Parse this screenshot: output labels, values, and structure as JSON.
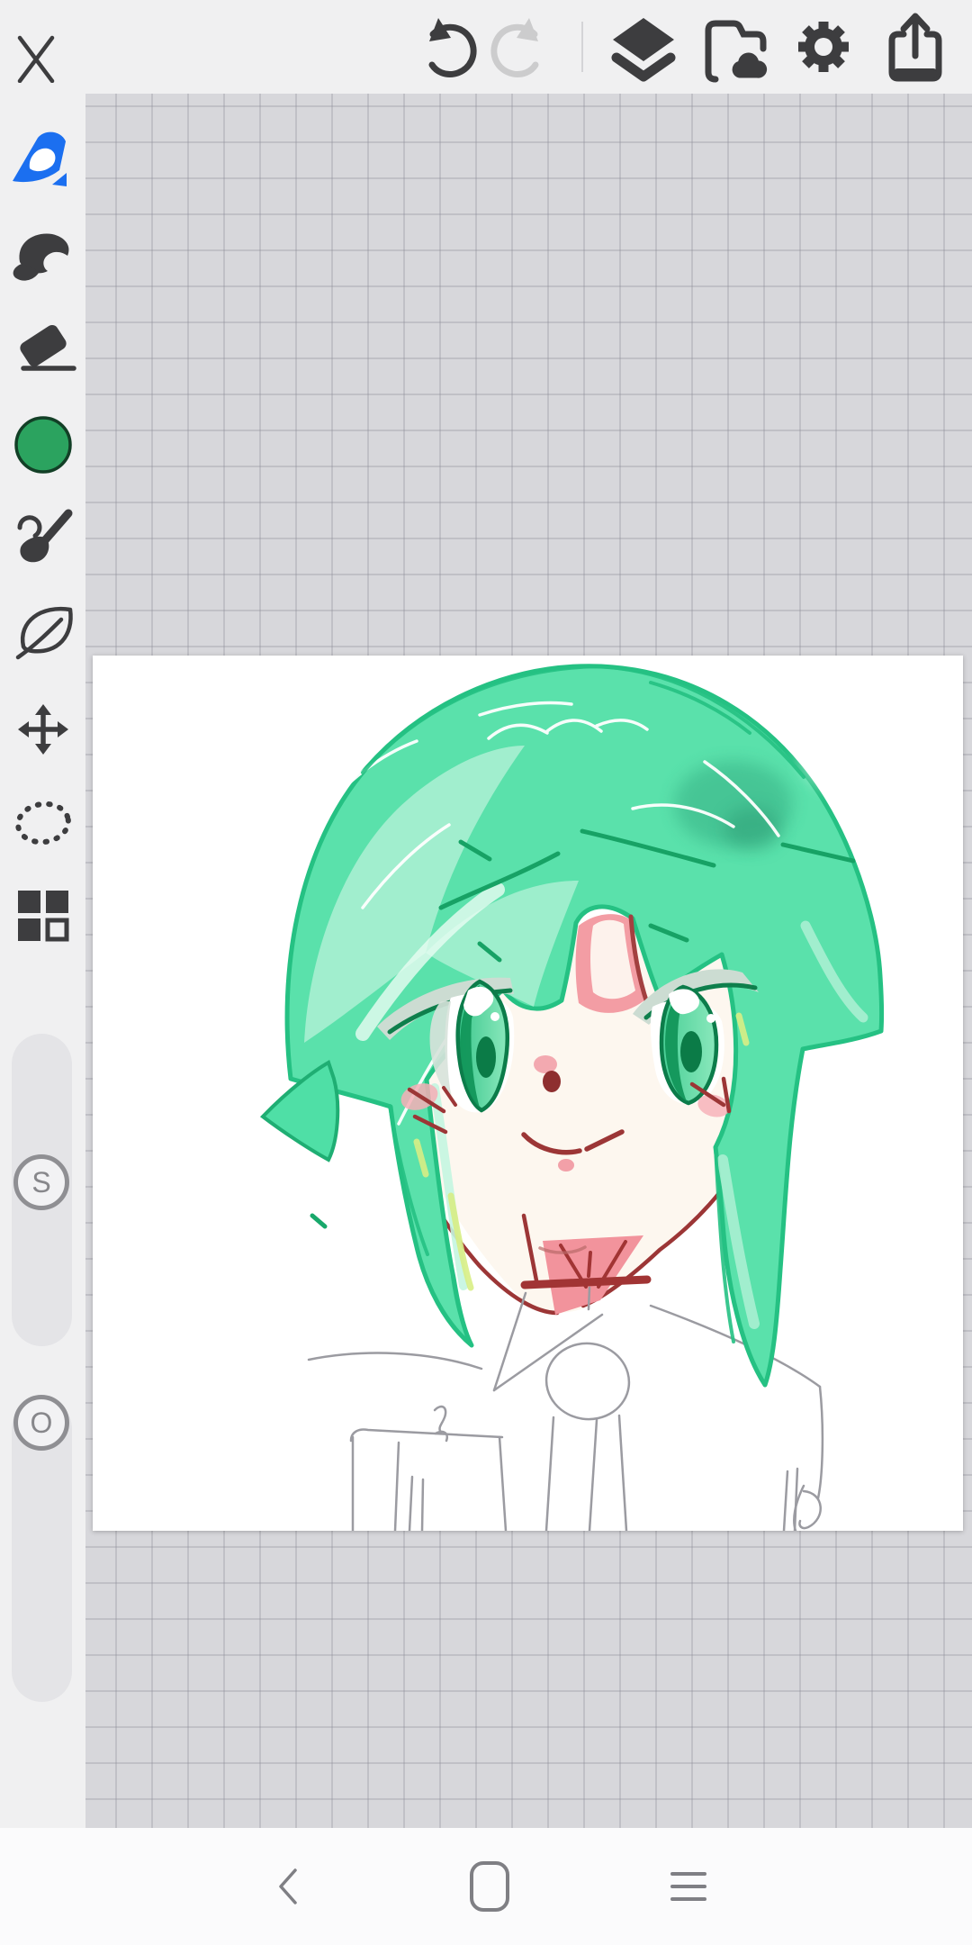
{
  "app": {
    "name": "mobile-painting-app",
    "view": "canvas-editor"
  },
  "topbar": {
    "close_label": "close",
    "undo_label": "undo",
    "undo_enabled": true,
    "redo_label": "redo",
    "redo_enabled": false,
    "layers_label": "layers",
    "gallery_label": "save-to-gallery",
    "settings_label": "settings",
    "share_label": "share",
    "icon_color": "#3d3d3f",
    "icon_disabled_color": "#cccccd"
  },
  "toolbar": {
    "pen_color": "#1b6ff0",
    "swatch_color": "#2ba35f",
    "tools": [
      {
        "id": "pen",
        "label": "pen-tool",
        "selected": true
      },
      {
        "id": "marker",
        "label": "marker-tool",
        "selected": false
      },
      {
        "id": "eraser",
        "label": "eraser-tool",
        "selected": false
      },
      {
        "id": "color",
        "label": "color-swatch",
        "selected": false
      },
      {
        "id": "brush",
        "label": "paint-brush-tool",
        "selected": false
      },
      {
        "id": "leaf",
        "label": "smudge-leaf-tool",
        "selected": false
      },
      {
        "id": "move",
        "label": "transform-tool",
        "selected": false
      },
      {
        "id": "lasso",
        "label": "lasso-select-tool",
        "selected": false
      },
      {
        "id": "pattern",
        "label": "layout-blocks-tool",
        "selected": false
      }
    ]
  },
  "sliders": {
    "size": {
      "label": "S",
      "position_fraction_from_top": 0.48
    },
    "opacity": {
      "label": "O",
      "position_fraction_from_top": 0.08
    }
  },
  "canvas": {
    "background": "#ffffff"
  },
  "artwork": {
    "description": "digital sketch of an anime character with mint green hair, green eyes and a white collared shirt",
    "palette": {
      "hair_base": "#5ae1ab",
      "hair_outline": "#25c183",
      "hair_highlight": "#bdf3dc",
      "hair_accent_dark": "#17a265",
      "hair_accent_yellow": "#d8ee85",
      "skin": "#fdf7ef",
      "line_red": "#9c3636",
      "blush_pink": "#f2a0a8",
      "neck_pink": "#f2939c",
      "eye_green_dark": "#0c7c4a",
      "eye_green_mid": "#12965a",
      "eye_green_light": "#7fe5b5",
      "sketch_gray": "#9b9ba1"
    }
  },
  "navbar": {
    "back_label": "back",
    "home_label": "home",
    "recents_label": "recents",
    "icon_color": "#7f7f84"
  }
}
